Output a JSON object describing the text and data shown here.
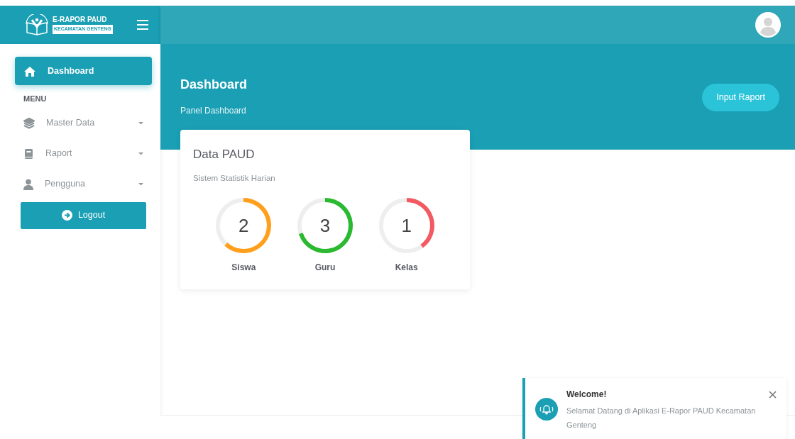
{
  "brand": {
    "title": "E-RAPOR PAUD",
    "subtitle": "KECAMATAN GENTENG"
  },
  "sidebar": {
    "items": [
      {
        "label": "Dashboard",
        "kind": "link",
        "selected": true
      },
      {
        "label": "MENU",
        "kind": "heading"
      },
      {
        "label": "Master Data",
        "kind": "dropdown",
        "selected": false
      },
      {
        "label": "Raport",
        "kind": "dropdown",
        "selected": false
      },
      {
        "label": "Pengguna",
        "kind": "dropdown",
        "selected": false
      }
    ],
    "logout": "Logout"
  },
  "page": {
    "title": "Dashboard",
    "subtitle": "Panel Dashboard",
    "button": "Input Raport"
  },
  "card": {
    "title": "Data PAUD",
    "subtitle": "Sistem Statistik Harian",
    "stats": [
      {
        "value": "2",
        "label": "Siswa",
        "color": "#ff9f1c"
      },
      {
        "value": "3",
        "label": "Guru",
        "color": "#2ab930"
      },
      {
        "value": "1",
        "label": "Kelas",
        "color": "#f25961"
      }
    ]
  },
  "toast": {
    "title": "Welcome!",
    "message": "Selamat Datang di Aplikasi E-Rapor PAUD Kecamatan Genteng"
  }
}
